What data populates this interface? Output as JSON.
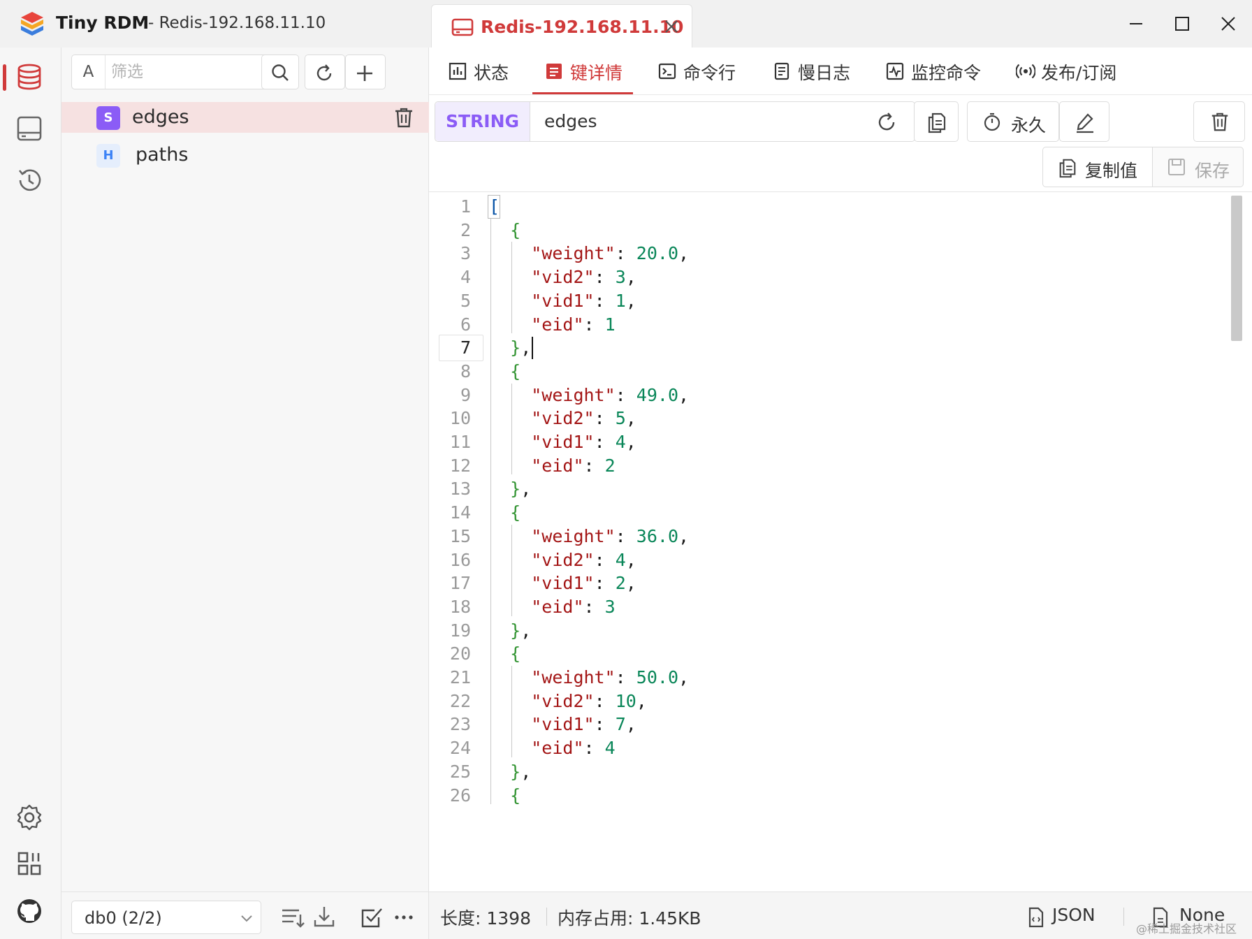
{
  "titlebar": {
    "app_name": "Tiny RDM",
    "subtitle": "- Redis-192.168.11.10",
    "tab_label": "Redis-192.168.11.10"
  },
  "rail": {
    "icons": [
      "database-icon",
      "server-icon",
      "history-icon",
      "settings-icon",
      "apps-grid-icon",
      "github-icon"
    ]
  },
  "browser": {
    "filter_mode": "A",
    "filter_placeholder": "筛选",
    "keys": [
      {
        "type": "S",
        "name": "edges",
        "selected": true
      },
      {
        "type": "H",
        "name": "paths",
        "selected": false
      }
    ],
    "db_select": "db0 (2/2)"
  },
  "tabs": [
    {
      "label": "状态",
      "icon": "status-icon",
      "active": false
    },
    {
      "label": "键详情",
      "icon": "key-detail-icon",
      "active": true
    },
    {
      "label": "命令行",
      "icon": "terminal-icon",
      "active": false
    },
    {
      "label": "慢日志",
      "icon": "slowlog-icon",
      "active": false
    },
    {
      "label": "监控命令",
      "icon": "monitor-icon",
      "active": false
    },
    {
      "label": "发布/订阅",
      "icon": "pubsub-icon",
      "active": false
    }
  ],
  "key_detail": {
    "type": "STRING",
    "name": "edges",
    "ttl_label": "永久",
    "copy_value_label": "复制值",
    "save_label": "保存"
  },
  "editor": {
    "current_line": 7,
    "lines": [
      "[",
      "  {",
      "    \"weight\": 20.0,",
      "    \"vid2\": 3,",
      "    \"vid1\": 1,",
      "    \"eid\": 1",
      "  },",
      "  {",
      "    \"weight\": 49.0,",
      "    \"vid2\": 5,",
      "    \"vid1\": 4,",
      "    \"eid\": 2",
      "  },",
      "  {",
      "    \"weight\": 36.0,",
      "    \"vid2\": 4,",
      "    \"vid1\": 2,",
      "    \"eid\": 3",
      "  },",
      "  {",
      "    \"weight\": 50.0,",
      "    \"vid2\": 10,",
      "    \"vid1\": 7,",
      "    \"eid\": 4",
      "  },",
      "  {"
    ]
  },
  "status": {
    "length": "长度: 1398",
    "memory": "内存占用: 1.45KB",
    "format": "JSON",
    "decode": "None"
  },
  "watermark": "@稀土掘金技术社区",
  "colors": {
    "accent": "#d03a3a",
    "string_type": "#8b5cf6",
    "hash_type": "#3b82f6"
  }
}
